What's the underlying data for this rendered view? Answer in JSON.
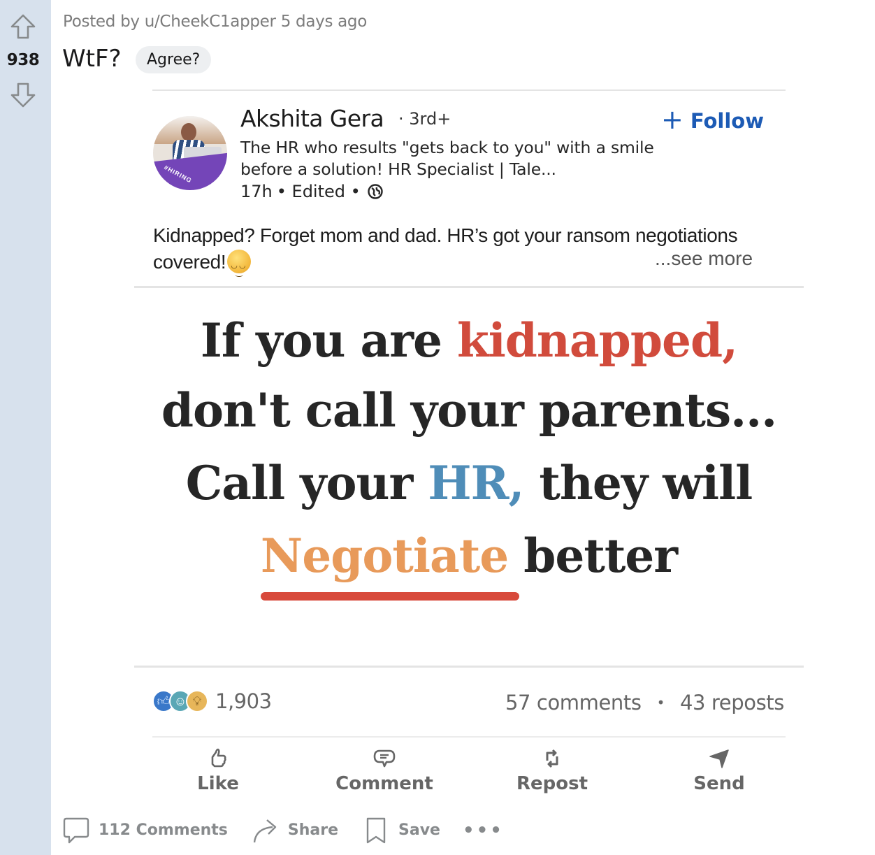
{
  "reddit": {
    "vote": {
      "upvote_icon": "arrow-up-outline-icon",
      "score": "938",
      "downvote_icon": "arrow-down-outline-icon"
    },
    "post": {
      "meta": "Posted by u/CheekC1apper 5 days ago",
      "title": "WtF?",
      "flair": "Agree?"
    },
    "footer": {
      "comments_label": "112 Comments",
      "share_label": "Share",
      "save_label": "Save",
      "more_label": "•••"
    }
  },
  "linkedin": {
    "author": {
      "name": "Akshita Gera",
      "degree": "· 3rd+",
      "headline": "The HR who results \"gets back to you\" with a smile before a solution! HR Specialist | Tale...",
      "time": "17h",
      "edited": "• Edited •",
      "visibility_icon": "globe-icon",
      "avatar_badge": "#HIRING"
    },
    "follow": {
      "plus": "+",
      "label": "Follow"
    },
    "text": "Kidnapped? Forget mom and dad. HR’s got your ransom negotiations covered!",
    "see_more": "...see more",
    "image": {
      "line1_a": "If you are ",
      "line1_b": "kidnapped,",
      "line2": "don't call your parents...",
      "line3_a": "Call your ",
      "line3_b": "HR,",
      "line3_c": " they will",
      "line4_a": "Negotiate",
      "line4_b": " better",
      "colors": {
        "dark": "#262626",
        "red": "#d14b3c",
        "blue": "#4f8db8",
        "orange": "#e89a5a"
      }
    },
    "stats": {
      "reactions": [
        "like",
        "funny",
        "insightful"
      ],
      "reaction_count": "1,903",
      "comments": "57 comments",
      "separator": "•",
      "reposts": "43 reposts"
    },
    "actions": [
      {
        "label": "Like",
        "icon": "thumbs-up-icon"
      },
      {
        "label": "Comment",
        "icon": "comment-bubble-icon"
      },
      {
        "label": "Repost",
        "icon": "repost-icon"
      },
      {
        "label": "Send",
        "icon": "send-icon"
      }
    ],
    "accent": "#1d5bb5"
  }
}
